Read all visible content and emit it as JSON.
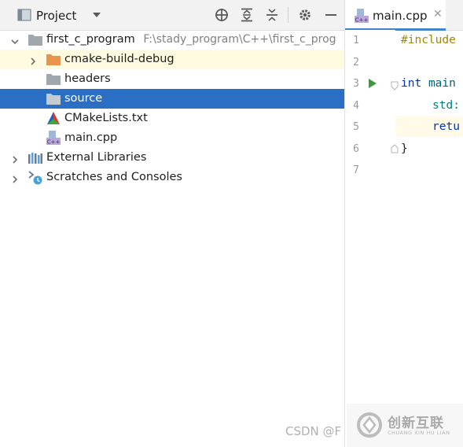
{
  "project_panel": {
    "title": "Project",
    "tree": [
      {
        "name": "first_c_program",
        "path": "F:\\stady_program\\C++\\first_c_prog"
      },
      {
        "name": "cmake-build-debug"
      },
      {
        "name": "headers"
      },
      {
        "name": "source"
      },
      {
        "name": "CMakeLists.txt"
      },
      {
        "name": "main.cpp"
      },
      {
        "name": "External Libraries"
      },
      {
        "name": "Scratches and Consoles"
      }
    ]
  },
  "editor": {
    "tab_label": "main.cpp",
    "line_numbers": [
      "1",
      "2",
      "3",
      "4",
      "5",
      "6",
      "7"
    ],
    "code": {
      "l1": "#include",
      "l3_kw": "int",
      "l3_fn": "main",
      "l4": "std:",
      "l5": "retu",
      "l6": "}"
    }
  },
  "watermark": {
    "csdn": "CSDN @F",
    "brand": "创新互联",
    "brand_sub": "CHUANG XIN HU LIAN"
  },
  "colors": {
    "selection": "#2a6fc4",
    "folder_orange": "#e8944d",
    "folder_gray": "#a0a7ad",
    "keyword": "#0033b3",
    "macro": "#9e880d",
    "run_green": "#3c9a3c",
    "tab_underline": "#4083c9"
  }
}
